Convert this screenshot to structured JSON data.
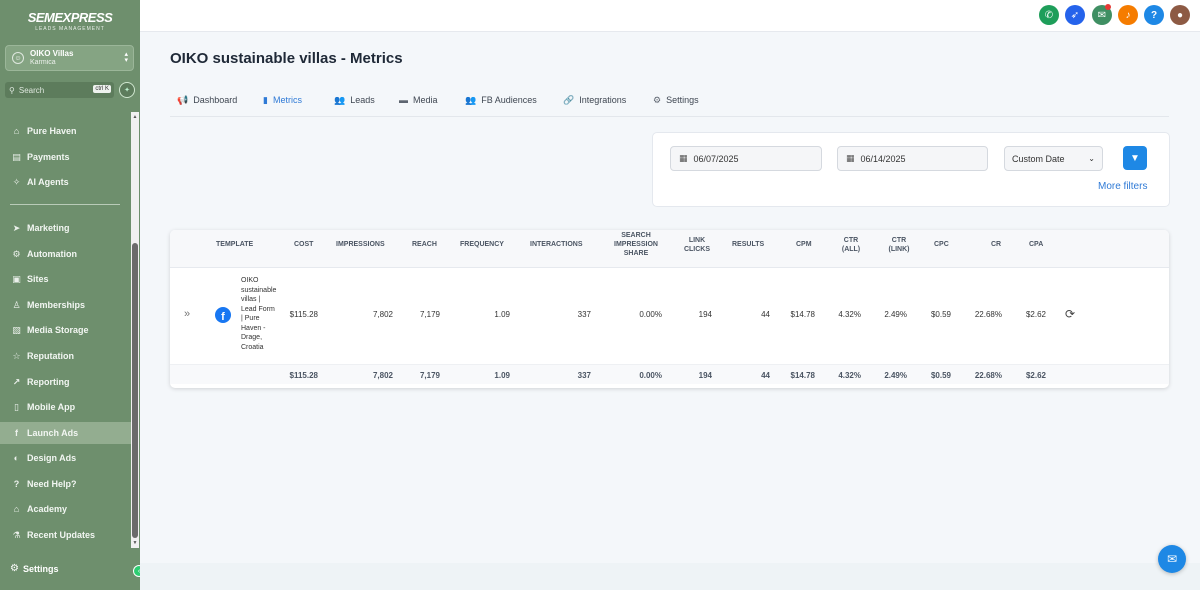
{
  "brand": {
    "logo_text": "SEMEXPRESS",
    "logo_sub": "LEADS MANAGEMENT"
  },
  "account": {
    "name": "OIKO Villas",
    "location": "Karmica"
  },
  "search": {
    "placeholder": "Search",
    "shortcut": "ctrl K"
  },
  "sidebar": {
    "items": [
      {
        "label": "Pure Haven",
        "icon": "home-icon"
      },
      {
        "label": "Payments",
        "icon": "receipt-icon"
      },
      {
        "label": "AI Agents",
        "icon": "sparkle-icon"
      },
      {
        "label": "Marketing",
        "icon": "send-icon"
      },
      {
        "label": "Automation",
        "icon": "robot-icon"
      },
      {
        "label": "Sites",
        "icon": "window-icon"
      },
      {
        "label": "Memberships",
        "icon": "badge-icon"
      },
      {
        "label": "Media Storage",
        "icon": "image-icon"
      },
      {
        "label": "Reputation",
        "icon": "star-icon"
      },
      {
        "label": "Reporting",
        "icon": "trend-icon"
      },
      {
        "label": "Mobile App",
        "icon": "phone-icon"
      },
      {
        "label": "Launch Ads",
        "icon": "facebook-icon"
      },
      {
        "label": "Design Ads",
        "icon": "palette-icon"
      },
      {
        "label": "Need Help?",
        "icon": "help-icon"
      },
      {
        "label": "Academy",
        "icon": "academy-icon"
      },
      {
        "label": "Recent Updates",
        "icon": "flask-icon"
      }
    ],
    "active": "Launch Ads",
    "settings_label": "Settings"
  },
  "page": {
    "title": "OIKO sustainable villas - Metrics"
  },
  "tabs": [
    {
      "label": "Dashboard",
      "icon": "megaphone-icon"
    },
    {
      "label": "Metrics",
      "icon": "bar-chart-icon"
    },
    {
      "label": "Leads",
      "icon": "users-icon"
    },
    {
      "label": "Media",
      "icon": "folder-icon"
    },
    {
      "label": "FB Audiences",
      "icon": "audience-icon"
    },
    {
      "label": "Integrations",
      "icon": "link-icon"
    },
    {
      "label": "Settings",
      "icon": "gear-icon"
    }
  ],
  "filters": {
    "start_date": "06/07/2025",
    "end_date": "06/14/2025",
    "range": "Custom Date",
    "more_filters": "More filters"
  },
  "table": {
    "headers": {
      "template": "TEMPLATE",
      "cost": "COST",
      "impressions": "IMPRESSIONS",
      "reach": "REACH",
      "frequency": "FREQUENCY",
      "interactions": "INTERACTIONS",
      "search_share_1": "SEARCH",
      "search_share_2": "IMPRESSION",
      "search_share_3": "SHARE",
      "link_clicks_1": "LINK",
      "link_clicks_2": "CLICKS",
      "results": "RESULTS",
      "cpm": "CPM",
      "ctr_all_1": "CTR",
      "ctr_all_2": "(ALL)",
      "ctr_link_1": "CTR",
      "ctr_link_2": "(LINK)",
      "cpc": "CPC",
      "cr": "CR",
      "cpa": "CPA"
    },
    "row": {
      "template_lines": [
        "OIKO",
        "sustainable",
        "villas |",
        "Lead Form",
        "| Pure",
        "Haven -",
        "Drage,",
        "Croatia"
      ],
      "cost": "$115.28",
      "impressions": "7,802",
      "reach": "7,179",
      "frequency": "1.09",
      "interactions": "337",
      "search_share": "0.00%",
      "link_clicks": "194",
      "results": "44",
      "cpm": "$14.78",
      "ctr_all": "4.32%",
      "ctr_link": "2.49%",
      "cpc": "$0.59",
      "cr": "22.68%",
      "cpa": "$2.62"
    },
    "totals": {
      "cost": "$115.28",
      "impressions": "7,802",
      "reach": "7,179",
      "frequency": "1.09",
      "interactions": "337",
      "search_share": "0.00%",
      "link_clicks": "194",
      "results": "44",
      "cpm": "$14.78",
      "ctr_all": "4.32%",
      "ctr_link": "2.49%",
      "cpc": "$0.59",
      "cr": "22.68%",
      "cpa": "$2.62"
    }
  },
  "colors": {
    "sidebar": "#6e8f6d",
    "accent": "#1e88e5",
    "active_tab": "#2f7ad6"
  }
}
